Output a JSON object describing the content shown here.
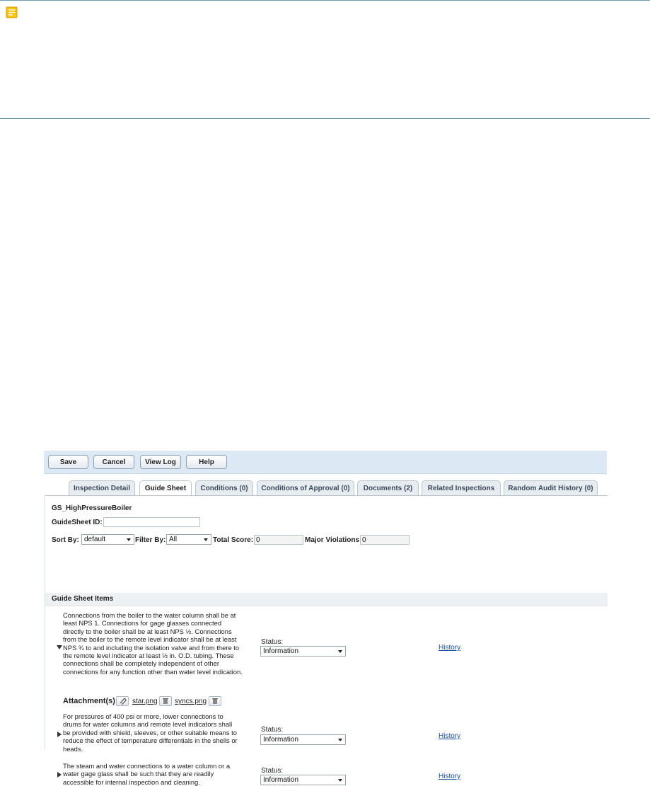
{
  "toolbar": {
    "save_label": "Save",
    "cancel_label": "Cancel",
    "view_log_label": "View Log",
    "help_label": "Help"
  },
  "tabs": [
    {
      "label": "Inspection Detail"
    },
    {
      "label": "Guide Sheet"
    },
    {
      "label": "Conditions (0)"
    },
    {
      "label": "Conditions of Approval (0)"
    },
    {
      "label": "Documents (2)"
    },
    {
      "label": "Related Inspections"
    },
    {
      "label": "Random Audit History (0)"
    }
  ],
  "active_tab": "Guide Sheet",
  "guidesheet": {
    "name": "GS_HighPressureBoiler",
    "id_label": "GuideSheet ID:",
    "id_value": "",
    "sort_by_label": "Sort By:",
    "sort_by_value": "default",
    "filter_by_label": "Filter By:",
    "filter_by_value": "All",
    "total_score_label": "Total Score:",
    "total_score_value": "0",
    "major_violations_label": "Major Violations:",
    "major_violations_value": "0",
    "items_header": "Guide Sheet Items"
  },
  "items": [
    {
      "lines": [
        "Connections from the boiler to the water column shall be at",
        "least NPS 1. Connections for gage glasses connected",
        "directly to the boiler shall be at least NPS ½. Connections",
        "from the boiler to the remote level indicator shall be at least",
        "NPS ¾ to and including the isolation valve and from there to",
        "the remote level indicator at least ½ in. O.D. tubing. These",
        "connections shall be completely independent of other",
        "connections for any function other than water level indication."
      ],
      "status_label": "Status:",
      "status_value": "Information",
      "history_label": "History",
      "expanded": true
    },
    {
      "lines": [
        "For pressures of 400 psi or more, lower connections to",
        "drums for water columns and remote level indicators shall",
        "be provided with shield, sleeves, or other suitable means to",
        "reduce the effect of temperature differentials in the shells or",
        "heads."
      ],
      "status_label": "Status:",
      "status_value": "Information",
      "history_label": "History",
      "expanded": false
    },
    {
      "lines": [
        "The steam and water connections to a water column or a",
        "water gage glass shall be such that they are readily",
        "accessible for internal inspection and cleaning."
      ],
      "status_label": "Status:",
      "status_value": "Information",
      "history_label": "History",
      "expanded": false
    }
  ],
  "attachments": {
    "label": "Attachment(s) :",
    "files": [
      "star.png",
      "syncs.png"
    ]
  },
  "colors": {
    "note_rule": "#6f98b8",
    "note_icon": "#f0b400",
    "toolbar_bg": "#dce8f4",
    "link": "#1a4ea0"
  },
  "icons": {
    "note": "note-icon",
    "attach": "paperclip-icon",
    "delete": "trash-icon",
    "expand": "triangle-down-icon",
    "collapse": "triangle-right-icon"
  }
}
